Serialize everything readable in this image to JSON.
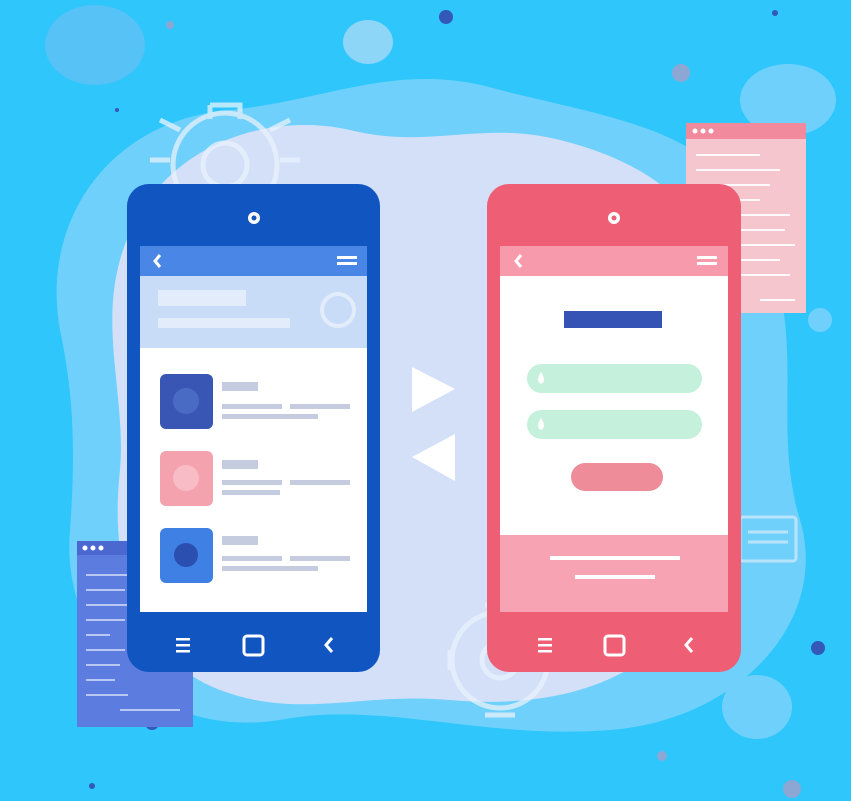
{
  "colors": {
    "background": "#2ec6fb",
    "blob_outer": "#6fd1fb",
    "blob_inner": "#d4e0f8",
    "left_phone_body": "#1055c0",
    "left_phone_header": "#4a86e6",
    "left_phone_banner": "#c9dcf7",
    "right_phone_body": "#ee5f76",
    "right_phone_header": "#f79aac",
    "right_phone_footer": "#f7a3b4",
    "input_field": "#c4f0dc",
    "title_bar": "#3552b5",
    "pink_button": "#ef8c9a",
    "code_window_left": "#5c7ce0",
    "code_window_right": "#f6c6cf",
    "arrows": "#ffffff"
  },
  "left_phone": {
    "list_items": [
      {
        "icon_color": "#3a56b4",
        "icon_inner": "#4a6bc4",
        "icon_name": "globe-icon"
      },
      {
        "icon_color": "#f4a3ae",
        "icon_inner": "#f7bcc5",
        "icon_name": "globe-icon"
      },
      {
        "icon_color": "#3f80e4",
        "icon_inner": "#2b4fb0",
        "icon_name": "circle-icon"
      }
    ],
    "nav_icons": [
      "menu-icon",
      "home-square-icon",
      "back-chevron-icon"
    ]
  },
  "right_phone": {
    "input_icons": [
      "drop-icon",
      "drop-icon"
    ],
    "nav_icons": [
      "menu-icon",
      "home-square-icon",
      "back-chevron-icon"
    ]
  }
}
